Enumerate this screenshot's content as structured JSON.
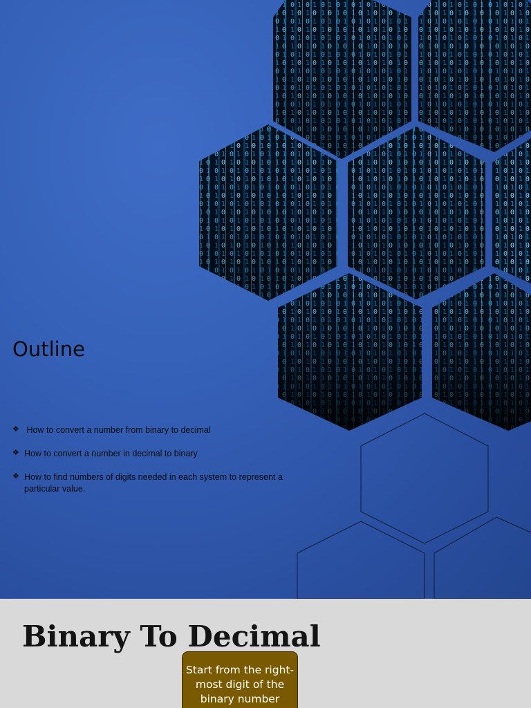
{
  "slide1": {
    "title": "Outline",
    "bullets": [
      " How to convert a number from binary to decimal",
      "How to convert a number in decimal to binary",
      "How to find numbers of digits needed in each system to represent a particular value."
    ],
    "bullet_icon": "diamond-bullet-icon",
    "background_color": "#3561b8",
    "matrix_colors": {
      "bright": "#4fc3ff",
      "mid": "#1e88c8",
      "dark": "#030b16"
    }
  },
  "slide2": {
    "title": "Binary To Decimal",
    "callout_text": "Start from the right-most digit of the binary number",
    "callout_color": "#7a5a00",
    "background_color": "#d9d9d9"
  }
}
